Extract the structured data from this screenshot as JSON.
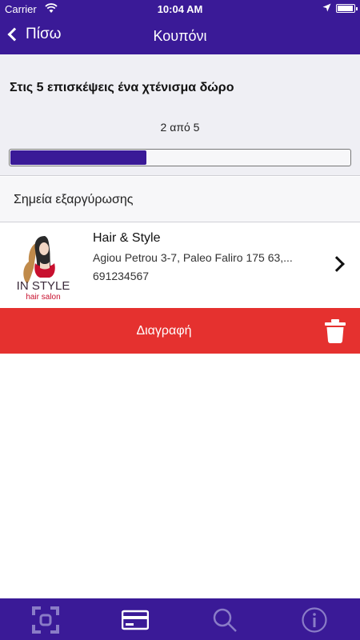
{
  "status_bar": {
    "carrier": "Carrier",
    "time": "10:04 AM"
  },
  "nav": {
    "back_label": "Πίσω",
    "title": "Κουπόνι"
  },
  "coupon": {
    "title": "Στις 5 επισκέψεις ένα χτένισμα δώρο",
    "progress_text": "2 από 5",
    "progress_fraction": 0.4
  },
  "redemption": {
    "section_label": "Σημεία εξαργύρωσης"
  },
  "store": {
    "logo_text_main": "IN STYLE",
    "logo_text_sub": "hair salon",
    "name": "Hair & Style",
    "address": "Agiou Petrou 3-7, Paleo Faliro 175 63,...",
    "phone": "691234567"
  },
  "delete": {
    "label": "Διαγραφή"
  },
  "tabs": [
    {
      "icon": "scan-icon"
    },
    {
      "icon": "card-icon"
    },
    {
      "icon": "search-icon"
    },
    {
      "icon": "info-icon"
    }
  ],
  "colors": {
    "primary": "#3a1a97",
    "danger": "#e5312f",
    "tab_inactive": "#8a7cc7"
  }
}
